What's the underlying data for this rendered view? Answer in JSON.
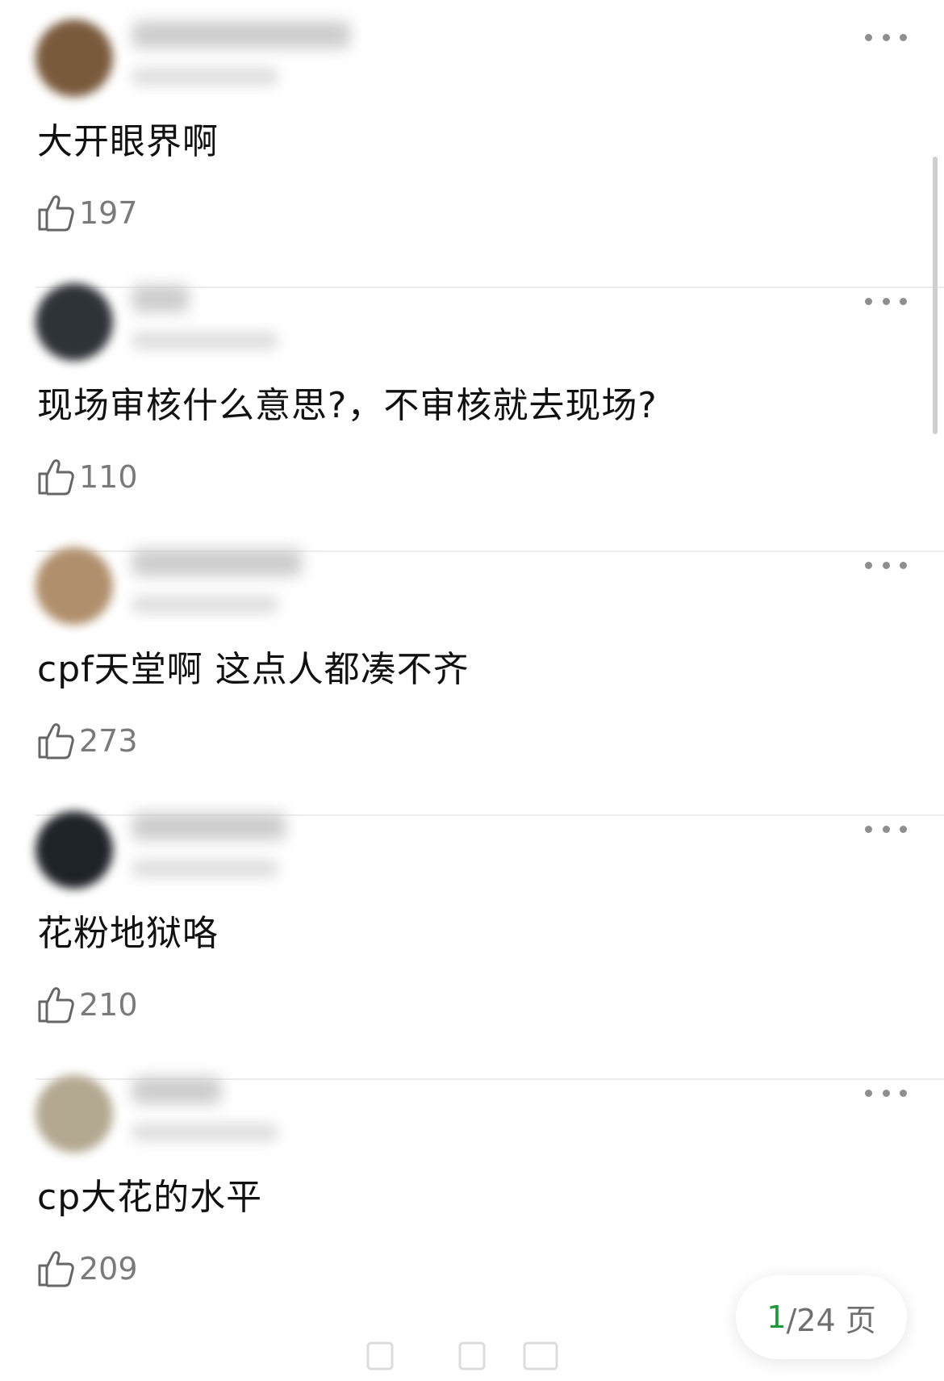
{
  "comments": [
    {
      "text": "大开眼界啊",
      "likes": "197",
      "avatar_color": "#7a5a3c",
      "username_blurred": true
    },
    {
      "text": "现场审核什么意思?，不审核就去现场?",
      "likes": "110",
      "avatar_color": "#2e3338",
      "username_blurred": true
    },
    {
      "text": "cpf天堂啊 这点人都凑不齐",
      "likes": "273",
      "avatar_color": "#b08f6c",
      "username_blurred": true
    },
    {
      "text": "花粉地狱咯",
      "likes": "210",
      "avatar_color": "#1e2328",
      "username_blurred": true
    },
    {
      "text": "cp大花的水平",
      "likes": "209",
      "avatar_color": "#b3a890",
      "username_blurred": true
    }
  ],
  "icons": {
    "more": "more-dots-icon",
    "like": "thumbs-up-icon"
  },
  "pager": {
    "current": "1",
    "total": "/24 页",
    "current_color": "#1f9a3a"
  }
}
